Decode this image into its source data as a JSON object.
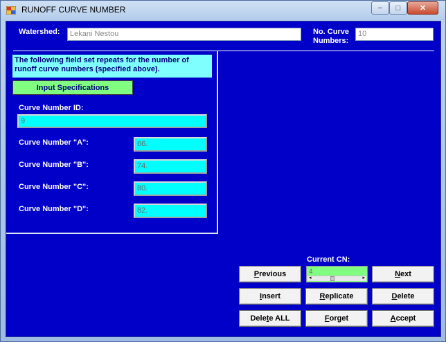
{
  "window": {
    "title": "RUNOFF CURVE NUMBER",
    "controls": {
      "minimize": "−",
      "maximize": "□",
      "close": "✕"
    }
  },
  "header": {
    "watershed_label": "Watershed:",
    "watershed_value": "Lekani Nestou",
    "num_label_line1": "No. Curve",
    "num_label_line2": "Numbers:",
    "num_value": "10"
  },
  "fieldset": {
    "info_text": "The following field set repeats for the number of runoff curve numbers (specified above).",
    "input_spec_button": "Input Specifications",
    "curve_id_label": "Curve Number ID:",
    "curve_id_value": "9",
    "fields": [
      {
        "label": "Curve Number \"A\":",
        "value": "66."
      },
      {
        "label": "Curve Number \"B\":",
        "value": "74."
      },
      {
        "label": "Curve Number \"C\":",
        "value": "80."
      },
      {
        "label": "Curve Number \"D\":",
        "value": "82."
      }
    ]
  },
  "nav": {
    "current_cn_label": "Current CN:",
    "current_cn_value": "4",
    "buttons": {
      "previous": "revious",
      "previous_key": "P",
      "next": "ext",
      "next_key": "N",
      "insert": "nsert",
      "insert_key": "I",
      "replicate": "eplicate",
      "replicate_key": "R",
      "delete": "elete",
      "delete_key": "D",
      "delete_all_pre": "Dele",
      "delete_all_key": "t",
      "delete_all_post": "e ALL",
      "forget": "orget",
      "forget_key": "F",
      "accept": "ccept",
      "accept_key": "A"
    }
  },
  "colors": {
    "client_bg": "#0000c8",
    "field_bg": "#00ffff",
    "info_bg": "#80ffff",
    "spec_button_bg": "#80ff80"
  }
}
